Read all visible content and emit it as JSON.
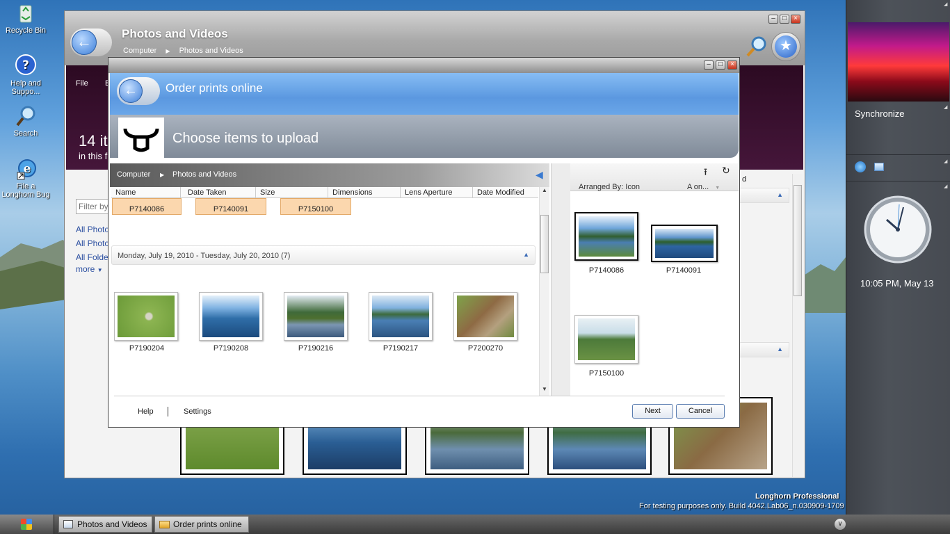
{
  "desktop": {
    "icons": [
      {
        "label": "Recycle Bin"
      },
      {
        "label": "Help and Suppo..."
      },
      {
        "label": "Search"
      },
      {
        "label": "File a Longhorn Bug"
      }
    ],
    "watermark": {
      "line1": "Longhorn Professional",
      "line2": "For testing purposes only. Build 4042.Lab06_n.030909-1709"
    }
  },
  "bg_window": {
    "title": "Photos and Videos",
    "breadcrumb": [
      "Computer",
      "Photos and Videos"
    ],
    "menu": {
      "file": "File",
      "edit": "E"
    },
    "count_big": "14 it",
    "count_sub": "in this f",
    "filter_placeholder": "Filter by",
    "links": [
      "All Photo",
      "All Photo",
      "All Folde",
      "more"
    ],
    "col_fragment": "d"
  },
  "dialog": {
    "title": "Order prints online",
    "step_title": "Choose items to upload",
    "breadcrumb": [
      "Computer",
      "Photos and Videos"
    ],
    "columns": [
      "Name",
      "Date Taken",
      "Size",
      "Dimensions",
      "Lens Aperture",
      "Date Modified"
    ],
    "top_selected": [
      "P7140086",
      "P7140091",
      "P7150100"
    ],
    "group_label": "Monday, July 19, 2010 - Tuesday, July 20, 2010 (7)",
    "items": [
      "P7190204",
      "P7190208",
      "P7190216",
      "P7190217",
      "P7200270"
    ],
    "right_panel": {
      "arranged_by": "Arranged By: Icon",
      "sort": "A on...",
      "items": [
        "P7140086",
        "P7140091",
        "P7150100"
      ]
    },
    "footer": {
      "help": "Help",
      "settings": "Settings",
      "next": "Next",
      "cancel": "Cancel"
    }
  },
  "sidebar": {
    "synchronize": "Synchronize",
    "clock": "10:05 PM, May 13"
  },
  "taskbar": {
    "buttons": [
      "Photos and Videos",
      "Order prints online"
    ]
  },
  "colors": {
    "dialog_header": "#6aa6e8",
    "menubar": "#3a1030",
    "sidebar": "#474b52"
  }
}
